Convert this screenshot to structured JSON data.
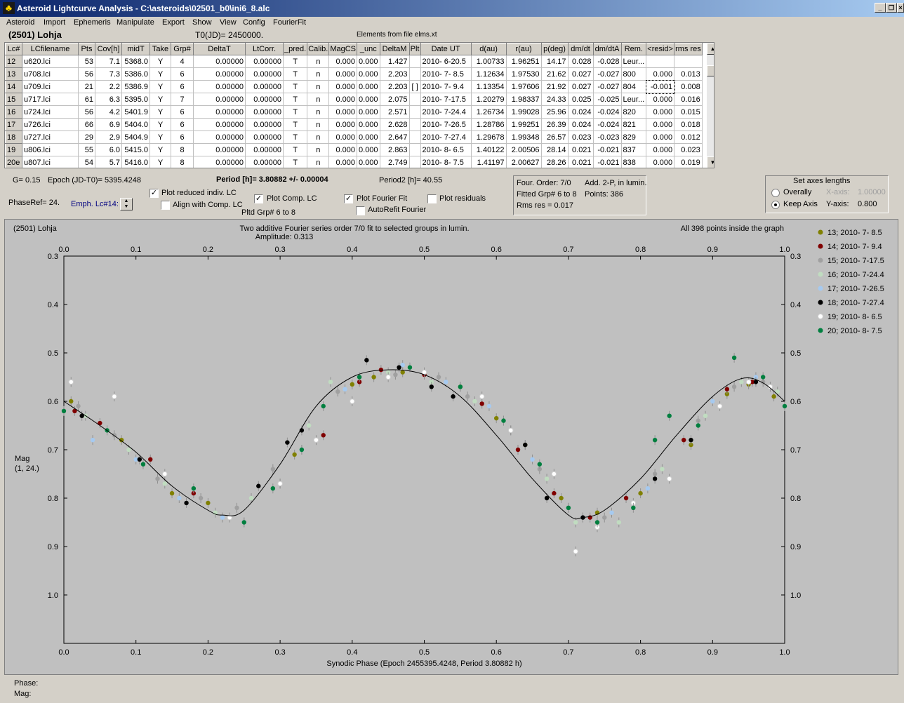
{
  "window": {
    "title": "Asteroid Lightcurve Analysis - C:\\asteroids\\02501_b0\\ini6_8.alc",
    "icon": "app-logo-icon"
  },
  "menu": [
    "Asteroid",
    "Import",
    "Ephemeris",
    "Manipulate",
    "Export",
    "Show",
    "View",
    "Config",
    "FourierFit"
  ],
  "header": {
    "asteroid": "(2501) Lohja",
    "t0": "T0(JD)= 2450000.",
    "elements": "Elements from file elms.xt"
  },
  "table": {
    "columns": [
      "Lc#",
      "LCfilename",
      "Pts",
      "Cov[h]",
      "midT",
      "Take",
      "Grp#",
      "DeltaT",
      "LtCorr.",
      "_pred.",
      "Calib.",
      "MagCS",
      "_unc",
      "DeltaM",
      "Plt",
      "Date UT",
      "d(au)",
      "r(au)",
      "p(deg)",
      "dm/dt",
      "dm/dtA",
      "Rem.",
      "<resid>",
      "rms res"
    ],
    "rows": [
      [
        "12",
        "u620.lci",
        "53",
        "7.1",
        "5368.0",
        "Y",
        "4",
        "0.00000",
        "0.00000",
        "T",
        "n",
        "0.000",
        "0.000",
        "1.427",
        "",
        "2010- 6-20.5",
        "1.00733",
        "1.96251",
        "14.17",
        "0.028",
        "-0.028",
        "Leur...",
        "",
        ""
      ],
      [
        "13",
        "u708.lci",
        "56",
        "7.3",
        "5386.0",
        "Y",
        "6",
        "0.00000",
        "0.00000",
        "T",
        "n",
        "0.000",
        "0.000",
        "2.203",
        "",
        "2010- 7- 8.5",
        "1.12634",
        "1.97530",
        "21.62",
        "0.027",
        "-0.027",
        "800",
        "0.000",
        "0.013"
      ],
      [
        "14",
        "u709.lci",
        "21",
        "2.2",
        "5386.9",
        "Y",
        "6",
        "0.00000",
        "0.00000",
        "T",
        "n",
        "0.000",
        "0.000",
        "2.203",
        "[ ]",
        "2010- 7- 9.4",
        "1.13354",
        "1.97606",
        "21.92",
        "0.027",
        "-0.027",
        "804",
        "-0.001",
        "0.008"
      ],
      [
        "15",
        "u717.lci",
        "61",
        "6.3",
        "5395.0",
        "Y",
        "7",
        "0.00000",
        "0.00000",
        "T",
        "n",
        "0.000",
        "0.000",
        "2.075",
        "",
        "2010- 7-17.5",
        "1.20279",
        "1.98337",
        "24.33",
        "0.025",
        "-0.025",
        "Leur...",
        "0.000",
        "0.016"
      ],
      [
        "16",
        "u724.lci",
        "56",
        "4.2",
        "5401.9",
        "Y",
        "6",
        "0.00000",
        "0.00000",
        "T",
        "n",
        "0.000",
        "0.000",
        "2.571",
        "",
        "2010- 7-24.4",
        "1.26734",
        "1.99028",
        "25.96",
        "0.024",
        "-0.024",
        "820",
        "0.000",
        "0.015"
      ],
      [
        "17",
        "u726.lci",
        "66",
        "6.9",
        "5404.0",
        "Y",
        "6",
        "0.00000",
        "0.00000",
        "T",
        "n",
        "0.000",
        "0.000",
        "2.628",
        "",
        "2010- 7-26.5",
        "1.28786",
        "1.99251",
        "26.39",
        "0.024",
        "-0.024",
        "821",
        "0.000",
        "0.018"
      ],
      [
        "18",
        "u727.lci",
        "29",
        "2.9",
        "5404.9",
        "Y",
        "6",
        "0.00000",
        "0.00000",
        "T",
        "n",
        "0.000",
        "0.000",
        "2.647",
        "",
        "2010- 7-27.4",
        "1.29678",
        "1.99348",
        "26.57",
        "0.023",
        "-0.023",
        "829",
        "0.000",
        "0.012"
      ],
      [
        "19",
        "u806.lci",
        "55",
        "6.0",
        "5415.0",
        "Y",
        "8",
        "0.00000",
        "0.00000",
        "T",
        "n",
        "0.000",
        "0.000",
        "2.863",
        "",
        "2010- 8- 6.5",
        "1.40122",
        "2.00506",
        "28.14",
        "0.021",
        "-0.021",
        "837",
        "0.000",
        "0.023"
      ],
      [
        "20e",
        "u807.lci",
        "54",
        "5.7",
        "5416.0",
        "Y",
        "8",
        "0.00000",
        "0.00000",
        "T",
        "n",
        "0.000",
        "0.000",
        "2.749",
        "",
        "2010- 8- 7.5",
        "1.41197",
        "2.00627",
        "28.26",
        "0.021",
        "-0.021",
        "838",
        "0.000",
        "0.019"
      ]
    ]
  },
  "info": {
    "g": "G= 0.15",
    "epoch": "Epoch (JD-T0)= 5395.4248",
    "period": "Period [h]= 3.80882 +/- 0.00004",
    "period2": "Period2 [h]= 40.55",
    "phaseref": "PhaseRef= 24.",
    "emph": "Emph. Lc#14:"
  },
  "options": {
    "plot_reduced": "Plot reduced indiv. LC",
    "align_comp": "Align with Comp. LC",
    "plot_comp": "Plot Comp. LC",
    "plot_fourier": "Plot Fourier Fit",
    "autorefit": "AutoRefit Fourier",
    "plot_residuals": "Plot residuals",
    "pltd_grp": "Pltd Grp#  6   to    8"
  },
  "fourier": {
    "order": "Four. Order:  7/0",
    "add": "Add. 2-P, in lumin.",
    "fitted": "Fitted Grp# 6 to 8",
    "points": "Points: 386",
    "rms": "Rms res      = 0.017"
  },
  "axes_box": {
    "title": "Set axes lengths",
    "overall": "Overally",
    "keep": "Keep Axis",
    "xaxis_label": "X-axis:",
    "xaxis_value": "1.00000",
    "yaxis_label": "Y-axis:",
    "yaxis_value": "0.800"
  },
  "status": {
    "phase": "Phase:",
    "mag": "Mag:"
  },
  "chart_data": {
    "type": "scatter",
    "title_left": "(2501) Lohja",
    "title": "Two additive Fourier series order 7/0 fit to selected groups in lumin.",
    "amplitude": "Amplitude: 0.313",
    "points_note": "All 398 points inside the graph",
    "xlabel": "Synodic Phase (Epoch 2455395.4248, Period 3.80882 h)",
    "ylabel": "Mag",
    "ylabel2": "(1, 24.)",
    "xlim": [
      0,
      1
    ],
    "ylim": [
      0.3,
      1.1
    ],
    "y_inverted": true,
    "xticks": [
      "0.0",
      "0.1",
      "0.2",
      "0.3",
      "0.4",
      "0.5",
      "0.6",
      "0.7",
      "0.8",
      "0.9",
      "1.0"
    ],
    "yticks": [
      "0.3",
      "0.4",
      "0.5",
      "0.6",
      "0.7",
      "0.8",
      "0.9",
      "1.0"
    ],
    "background": "#c0c0c0",
    "fit_curve": {
      "x": [
        0.0,
        0.05,
        0.1,
        0.15,
        0.2,
        0.22,
        0.25,
        0.3,
        0.35,
        0.4,
        0.45,
        0.5,
        0.55,
        0.6,
        0.65,
        0.7,
        0.72,
        0.75,
        0.8,
        0.85,
        0.9,
        0.94,
        0.97,
        1.0
      ],
      "y": [
        0.6,
        0.65,
        0.705,
        0.775,
        0.825,
        0.835,
        0.825,
        0.73,
        0.61,
        0.55,
        0.535,
        0.545,
        0.59,
        0.67,
        0.76,
        0.835,
        0.84,
        0.825,
        0.76,
        0.67,
        0.59,
        0.553,
        0.562,
        0.6
      ]
    },
    "series": [
      {
        "name": "13; 2010- 7- 8.5",
        "color": "#808000",
        "x": [
          0.01,
          0.08,
          0.15,
          0.2,
          0.32,
          0.4,
          0.43,
          0.47,
          0.55,
          0.6,
          0.64,
          0.69,
          0.74,
          0.8,
          0.87,
          0.92,
          0.95,
          0.985
        ],
        "y": [
          0.6,
          0.68,
          0.79,
          0.81,
          0.71,
          0.565,
          0.55,
          0.54,
          0.57,
          0.635,
          0.69,
          0.8,
          0.83,
          0.79,
          0.69,
          0.585,
          0.565,
          0.59
        ]
      },
      {
        "name": "14; 2010- 7- 9.4",
        "color": "#800000",
        "x": [
          0.015,
          0.05,
          0.12,
          0.18,
          0.3,
          0.36,
          0.41,
          0.44,
          0.5,
          0.58,
          0.63,
          0.68,
          0.73,
          0.78,
          0.86,
          0.92,
          0.955,
          0.98
        ],
        "y": [
          0.62,
          0.645,
          0.72,
          0.79,
          0.77,
          0.67,
          0.56,
          0.535,
          0.545,
          0.605,
          0.7,
          0.79,
          0.84,
          0.8,
          0.68,
          0.575,
          0.56,
          0.57
        ]
      },
      {
        "name": "15; 2010- 7-17.5",
        "color": "#a0a0a0",
        "x": [
          0.02,
          0.07,
          0.13,
          0.19,
          0.24,
          0.29,
          0.38,
          0.46,
          0.52,
          0.56,
          0.62,
          0.66,
          0.7,
          0.75,
          0.82,
          0.88,
          0.93,
          0.97
        ],
        "y": [
          0.61,
          0.67,
          0.76,
          0.8,
          0.82,
          0.74,
          0.58,
          0.545,
          0.55,
          0.59,
          0.66,
          0.74,
          0.82,
          0.84,
          0.75,
          0.64,
          0.57,
          0.56
        ]
      },
      {
        "name": "16; 2010- 7-24.4",
        "color": "#c0dcc0",
        "x": [
          0.03,
          0.09,
          0.14,
          0.21,
          0.26,
          0.34,
          0.37,
          0.45,
          0.51,
          0.57,
          0.61,
          0.67,
          0.71,
          0.77,
          0.83,
          0.89,
          0.94,
          0.99
        ],
        "y": [
          0.63,
          0.7,
          0.77,
          0.83,
          0.8,
          0.65,
          0.56,
          0.54,
          0.56,
          0.6,
          0.64,
          0.76,
          0.85,
          0.85,
          0.74,
          0.63,
          0.56,
          0.58
        ]
      },
      {
        "name": "17; 2010- 7-26.5",
        "color": "#a6caf0",
        "x": [
          0.04,
          0.1,
          0.16,
          0.22,
          0.25,
          0.33,
          0.39,
          0.47,
          0.53,
          0.59,
          0.65,
          0.72,
          0.76,
          0.81,
          0.9,
          0.96
        ],
        "y": [
          0.68,
          0.72,
          0.8,
          0.84,
          0.85,
          0.7,
          0.575,
          0.525,
          0.56,
          0.61,
          0.72,
          0.84,
          0.83,
          0.78,
          0.6,
          0.55
        ]
      },
      {
        "name": "18; 2010- 7-27.4",
        "color": "#000000",
        "x": [
          0.025,
          0.105,
          0.17,
          0.27,
          0.31,
          0.33,
          0.42,
          0.465,
          0.51,
          0.54,
          0.64,
          0.67,
          0.72,
          0.82,
          0.87,
          0.96
        ],
        "y": [
          0.63,
          0.72,
          0.81,
          0.775,
          0.685,
          0.66,
          0.515,
          0.53,
          0.57,
          0.59,
          0.69,
          0.8,
          0.84,
          0.76,
          0.68,
          0.56
        ]
      },
      {
        "name": "19; 2010- 8- 6.5",
        "color": "#ffffff",
        "x": [
          0.01,
          0.07,
          0.14,
          0.23,
          0.3,
          0.35,
          0.4,
          0.45,
          0.5,
          0.58,
          0.62,
          0.68,
          0.71,
          0.74,
          0.79,
          0.84,
          0.91,
          0.95,
          0.98
        ],
        "y": [
          0.56,
          0.59,
          0.75,
          0.84,
          0.77,
          0.68,
          0.6,
          0.55,
          0.54,
          0.59,
          0.66,
          0.75,
          0.91,
          0.86,
          0.81,
          0.76,
          0.61,
          0.56,
          0.57
        ]
      },
      {
        "name": "20; 2010- 8- 7.5",
        "color": "#007f3f",
        "x": [
          0.0,
          0.06,
          0.11,
          0.18,
          0.25,
          0.29,
          0.33,
          0.36,
          0.41,
          0.48,
          0.55,
          0.61,
          0.66,
          0.7,
          0.74,
          0.79,
          0.82,
          0.84,
          0.88,
          0.93,
          0.97,
          1.0
        ],
        "y": [
          0.62,
          0.66,
          0.73,
          0.78,
          0.85,
          0.78,
          0.7,
          0.61,
          0.55,
          0.53,
          0.57,
          0.64,
          0.73,
          0.82,
          0.85,
          0.82,
          0.68,
          0.63,
          0.65,
          0.51,
          0.55,
          0.61
        ]
      }
    ]
  }
}
